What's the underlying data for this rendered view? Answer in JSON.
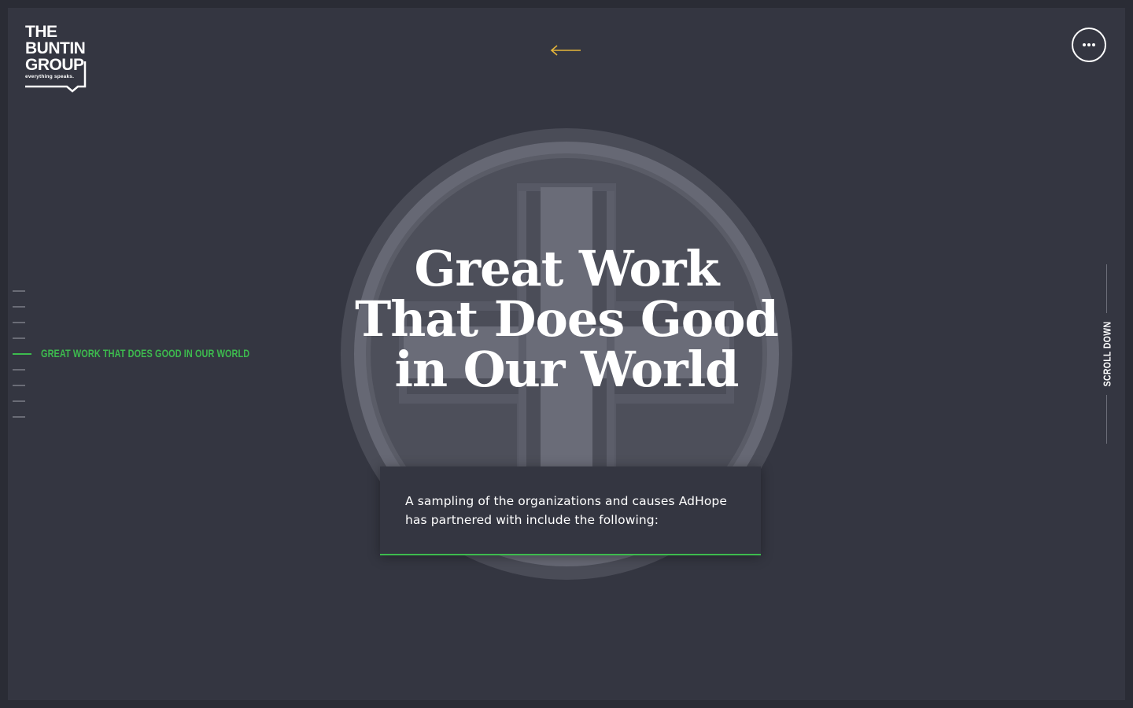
{
  "brand": {
    "logo_line1": "THE",
    "logo_line2": "BUNTIN",
    "logo_line3": "GROUP",
    "tagline": "everything speaks."
  },
  "header": {
    "back_icon": "left-arrow-icon",
    "menu_icon": "ellipsis-icon"
  },
  "section_nav": {
    "items": [
      {
        "label": "",
        "active": false
      },
      {
        "label": "",
        "active": false
      },
      {
        "label": "",
        "active": false
      },
      {
        "label": "",
        "active": false
      },
      {
        "label": "GREAT WORK THAT DOES GOOD IN OUR WORLD",
        "active": true
      },
      {
        "label": "",
        "active": false
      },
      {
        "label": "",
        "active": false
      },
      {
        "label": "",
        "active": false
      },
      {
        "label": "",
        "active": false
      }
    ]
  },
  "hero": {
    "title": "Great Work That Does Good in Our World",
    "intro": "A sampling of the organizations and causes AdHope has partnered with include the following:"
  },
  "scroll": {
    "label": "SCROLL DOWN"
  },
  "colors": {
    "background": "#343641",
    "accent_green": "#3dbb4e",
    "arrow_yellow": "#e5b53a",
    "emblem_gray": "#62646e"
  }
}
